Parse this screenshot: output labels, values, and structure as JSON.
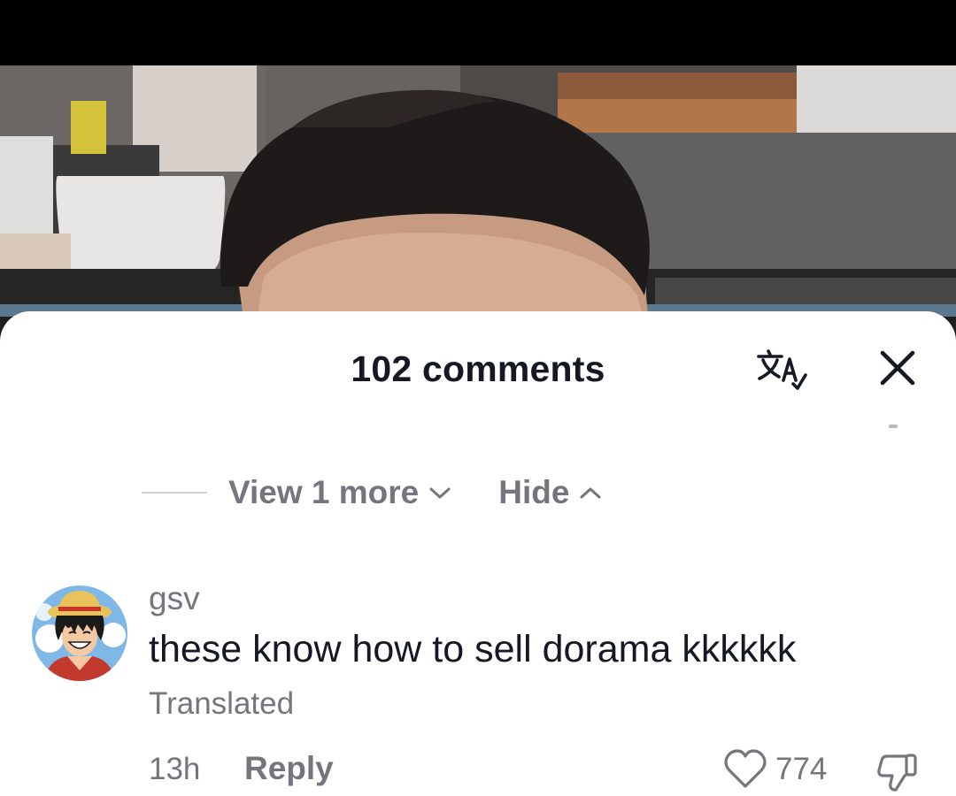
{
  "header": {
    "comment_count_title": "102 comments",
    "icons": [
      "translate-icon",
      "close-icon"
    ]
  },
  "replies": {
    "view_more_label": "View 1 more",
    "hide_label": "Hide"
  },
  "comment": {
    "username": "gsv",
    "text": "these know how to sell dorama kkkkkk",
    "translated_label": "Translated",
    "timestamp": "13h",
    "reply_label": "Reply",
    "like_count": "774",
    "icons": [
      "heart-icon",
      "dislike-icon"
    ]
  },
  "colors": {
    "sheet_background": "#ffffff",
    "primary_text": "#161823",
    "secondary_text": "#75767d",
    "status_bar": "#000000"
  }
}
